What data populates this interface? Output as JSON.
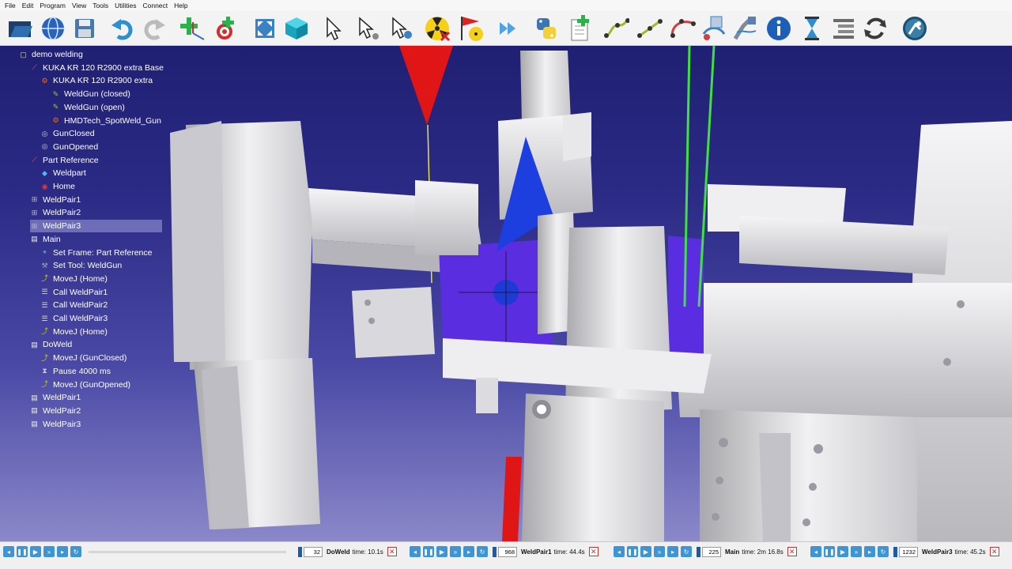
{
  "menu": [
    "File",
    "Edit",
    "Program",
    "View",
    "Tools",
    "Utilities",
    "Connect",
    "Help"
  ],
  "toolbar_icons": [
    "open-folder-icon",
    "globe-icon",
    "save-icon",
    "undo-icon",
    "redo-icon",
    "add-frame-icon",
    "add-target-icon",
    "fit-all-icon",
    "3d-view-icon",
    "select-icon",
    "select-tool-icon",
    "select-target-icon",
    "collision-off-icon",
    "collision-flag-icon",
    "fast-forward-icon",
    "python-icon",
    "add-program-icon",
    "move-joint-icon",
    "move-linear-icon",
    "move-circular-icon",
    "make-program-icon",
    "set-tool-icon",
    "info-icon",
    "pause-icon",
    "program-list-icon",
    "loop-icon",
    "settings-icon"
  ],
  "tree": [
    {
      "label": "demo welding",
      "icon": "station-icon",
      "depth": 0
    },
    {
      "label": "KUKA KR 120 R2900 extra Base",
      "icon": "frame-icon",
      "depth": 1
    },
    {
      "label": "KUKA KR 120 R2900 extra",
      "icon": "robot-icon",
      "depth": 2
    },
    {
      "label": "WeldGun (closed)",
      "icon": "tool-icon",
      "depth": 3
    },
    {
      "label": "WeldGun (open)",
      "icon": "tool-icon",
      "depth": 3
    },
    {
      "label": "HMDTech_SpotWeld_Gun",
      "icon": "robot-icon",
      "depth": 3
    },
    {
      "label": "GunClosed",
      "icon": "target-icon",
      "depth": 2
    },
    {
      "label": "GunOpened",
      "icon": "target-icon",
      "depth": 2
    },
    {
      "label": "Part Reference",
      "icon": "frame-icon",
      "depth": 1
    },
    {
      "label": "Weldpart",
      "icon": "object-icon",
      "depth": 2
    },
    {
      "label": "Home",
      "icon": "home-target-icon",
      "depth": 2
    },
    {
      "label": "WeldPair1",
      "icon": "weld-pair-icon",
      "depth": 1
    },
    {
      "label": "WeldPair2",
      "icon": "weld-pair-icon",
      "depth": 1
    },
    {
      "label": "WeldPair3",
      "icon": "weld-pair-icon",
      "depth": 1,
      "selected": true
    },
    {
      "label": "Main",
      "icon": "program-icon",
      "depth": 1
    },
    {
      "label": "Set Frame: Part Reference",
      "icon": "set-frame-icon",
      "depth": 2
    },
    {
      "label": "Set Tool: WeldGun",
      "icon": "set-tool-icon",
      "depth": 2
    },
    {
      "label": "MoveJ (Home)",
      "icon": "movej-icon",
      "depth": 2
    },
    {
      "label": "Call WeldPair1",
      "icon": "call-icon",
      "depth": 2
    },
    {
      "label": "Call WeldPair2",
      "icon": "call-icon",
      "depth": 2
    },
    {
      "label": "Call WeldPair3",
      "icon": "call-icon",
      "depth": 2
    },
    {
      "label": "MoveJ (Home)",
      "icon": "movej-icon",
      "depth": 2
    },
    {
      "label": "DoWeld",
      "icon": "program-icon",
      "depth": 1
    },
    {
      "label": "MoveJ (GunClosed)",
      "icon": "movej-icon",
      "depth": 2
    },
    {
      "label": "Pause 4000 ms",
      "icon": "pause-icon",
      "depth": 2
    },
    {
      "label": "MoveJ (GunOpened)",
      "icon": "movej-icon",
      "depth": 2
    },
    {
      "label": "WeldPair1",
      "icon": "program-icon",
      "depth": 1
    },
    {
      "label": "WeldPair2",
      "icon": "program-icon",
      "depth": 1
    },
    {
      "label": "WeldPair3",
      "icon": "program-icon",
      "depth": 1
    }
  ],
  "status": {
    "p1": {
      "count": "32",
      "name": "DoWeld",
      "time": "time: 10.1s"
    },
    "p2": {
      "count": "968",
      "name": "WeldPair1",
      "time": "time: 44.4s"
    },
    "p3": {
      "count": "225",
      "name": "Main",
      "time": "time: 2m 16.8s"
    },
    "p4": {
      "count": "1232",
      "name": "WeldPair3",
      "time": "time: 45.2s"
    }
  },
  "colors": {
    "viewport_top": "#1f1f73",
    "viewport_bottom": "#8b88c9",
    "accent": "#3f95d3",
    "selected_part": "#5a2ee0"
  }
}
